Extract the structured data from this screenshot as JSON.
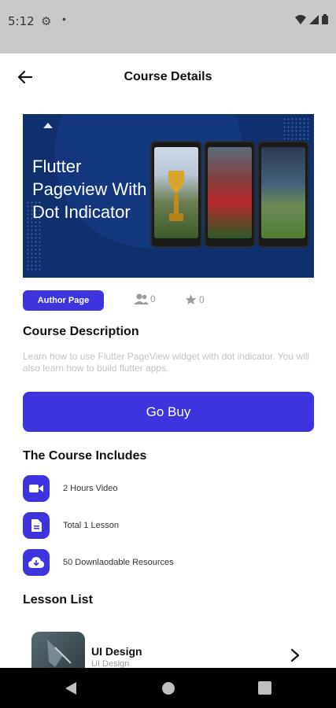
{
  "status_bar": {
    "time": "5:12",
    "icons": [
      "gear-icon",
      "notification-dot-icon",
      "wifi-icon",
      "cellular-signal-icon",
      "battery-icon"
    ]
  },
  "app_bar": {
    "title": "Course Details",
    "back_icon": "arrow-left-icon"
  },
  "banner": {
    "title": "Flutter Pageview With Dot Indicator",
    "background_color": "#0f2f6e"
  },
  "meta": {
    "author_button_label": "Author Page",
    "students_count": "0",
    "rating_count": "0"
  },
  "description": {
    "heading": "Course Description",
    "text": "Learn how to use Flutter PageView widget with dot indicator. You will also learn how to build flutter apps."
  },
  "buy_button_label": "Go Buy",
  "includes": {
    "heading": "The Course Includes",
    "items": [
      {
        "icon": "video-camera-icon",
        "label": "2 Hours Video"
      },
      {
        "icon": "document-icon",
        "label": "Total 1 Lesson"
      },
      {
        "icon": "cloud-download-icon",
        "label": "50  Downlaodable Resources"
      }
    ]
  },
  "lessons": {
    "heading": "Lesson List",
    "items": [
      {
        "title": "UI Design",
        "subtitle": "UI Design"
      }
    ]
  },
  "nav_bar": {
    "icons": [
      "back-triangle-icon",
      "home-circle-icon",
      "recents-square-icon"
    ]
  },
  "colors": {
    "accent": "#3d34e0",
    "status_bar": "#c9c9c9",
    "muted_text": "#c2c2c2"
  }
}
